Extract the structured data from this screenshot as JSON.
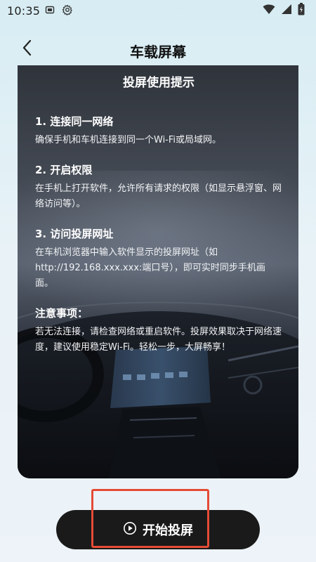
{
  "status_bar": {
    "time": "10:35",
    "icons": [
      "notification-icon",
      "settings-gear-icon",
      "wifi-icon",
      "signal-icon",
      "battery-icon"
    ]
  },
  "header": {
    "title": "车载屏幕",
    "back_icon": "chevron-left-icon"
  },
  "card": {
    "title": "投屏使用提示",
    "sections": [
      {
        "title": "1. 连接同一网络",
        "text": "确保手机和车机连接到同一个Wi-Fi或局域网。"
      },
      {
        "title": "2. 开启权限",
        "text": "在手机上打开软件，允许所有请求的权限（如显示悬浮窗、网络访问等）。"
      },
      {
        "title": "3. 访问投屏网址",
        "text": "在车机浏览器中输入软件显示的投屏网址（如 http://192.168.xxx.xxx:端口号），即可实时同步手机画面。"
      },
      {
        "title": "注意事项：",
        "text": "若无法连接，请检查网络或重启软件。投屏效果取决于网络速度，建议使用稳定Wi-Fi。轻松一步，大屏畅享！"
      }
    ]
  },
  "start_button": {
    "label": "开始投屏",
    "icon": "play-circle-icon"
  },
  "colors": {
    "accent_box": "#e54b36",
    "button_bg": "#1a1a1a"
  }
}
